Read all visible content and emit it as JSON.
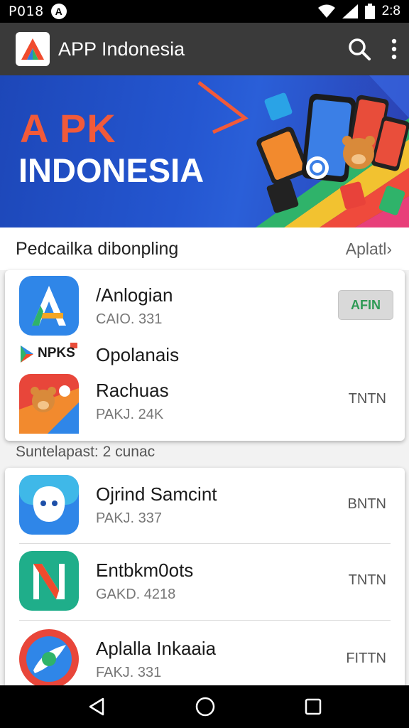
{
  "status_bar": {
    "left_text": "P018",
    "badge": "A",
    "time": "2:8"
  },
  "app_bar": {
    "title": "APP Indonesia"
  },
  "banner": {
    "line1": "A PK",
    "line2": "INDONESIA"
  },
  "section": {
    "title": "Pedcailka dibonpling",
    "link": "Aplatl›"
  },
  "featured": [
    {
      "name": "/Anlogian",
      "meta": "CAIO. 331",
      "button": "AFIN",
      "icon": "a-letter-app-icon"
    },
    {
      "name": "Opolanais",
      "icon": "npks-play-icon",
      "icon_text": "NPKS"
    },
    {
      "name": "Rachuas",
      "meta": "PAKJ. 24K",
      "action": "TNTN",
      "icon": "bear-app-icon"
    }
  ],
  "subheader": "Suntelapast: 2 cunac",
  "apps": [
    {
      "name": "Ojrind Samcint",
      "meta": "PAKJ. 337",
      "action": "BNTN",
      "icon": "blob-app-icon"
    },
    {
      "name": "Entbkm0ots",
      "meta": "GAKD. 4218",
      "action": "TNTN",
      "icon": "n-letter-app-icon"
    },
    {
      "name": "Aplalla Inkaaia",
      "meta": "FAKJ. 331",
      "action": "FITTN",
      "icon": "swirl-app-icon"
    }
  ],
  "colors": {
    "app_bar": "#3a3a3a",
    "banner_blue": "#2456d0",
    "banner_accent": "#f15a3a",
    "install_text": "#2e9a55"
  }
}
